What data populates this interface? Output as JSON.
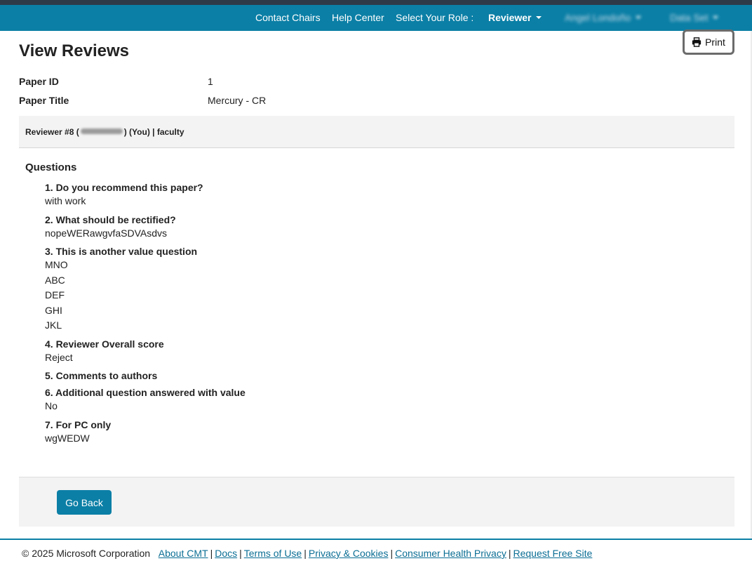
{
  "nav": {
    "contact_chairs": "Contact Chairs",
    "help_center": "Help Center",
    "select_role_label": "Select Your Role :",
    "role": "Reviewer",
    "user_name": "Angel Londoño",
    "extra_menu": "Data Set"
  },
  "toolbar": {
    "print_label": "Print"
  },
  "page": {
    "title": "View Reviews",
    "paper_id_label": "Paper ID",
    "paper_id": "1",
    "paper_title_label": "Paper Title",
    "paper_title": "Mercury - CR"
  },
  "reviewer": {
    "prefix": "Reviewer #8 (",
    "suffix": ")  (You)  | faculty"
  },
  "questions": {
    "heading": "Questions",
    "items": [
      {
        "label": "1. Do you recommend this paper?",
        "answers": [
          "with work"
        ]
      },
      {
        "label": "2. What should be rectified?",
        "answers": [
          "nopeWERawgvfaSDVAsdvs"
        ]
      },
      {
        "label": "3. This is another value question",
        "answers": [
          "MNO",
          "ABC",
          "DEF",
          "GHI",
          "JKL"
        ]
      },
      {
        "label": "4. Reviewer Overall score",
        "answers": [
          "Reject"
        ]
      },
      {
        "label": "5. Comments to authors",
        "answers": []
      },
      {
        "label": "6. Additional question answered with value",
        "answers": [
          "No"
        ]
      },
      {
        "label": "7. For PC only",
        "answers": [
          "wgWEDW"
        ]
      }
    ]
  },
  "actions": {
    "go_back": "Go Back"
  },
  "footer": {
    "copyright": "© 2025 Microsoft Corporation",
    "links": [
      "About CMT",
      "Docs",
      "Terms of Use",
      "Privacy & Cookies",
      "Consumer Health Privacy",
      "Request Free Site"
    ]
  },
  "colors": {
    "brand": "#0b7fa6",
    "topstrip": "#2f3a48",
    "panel": "#f3f3f3"
  }
}
